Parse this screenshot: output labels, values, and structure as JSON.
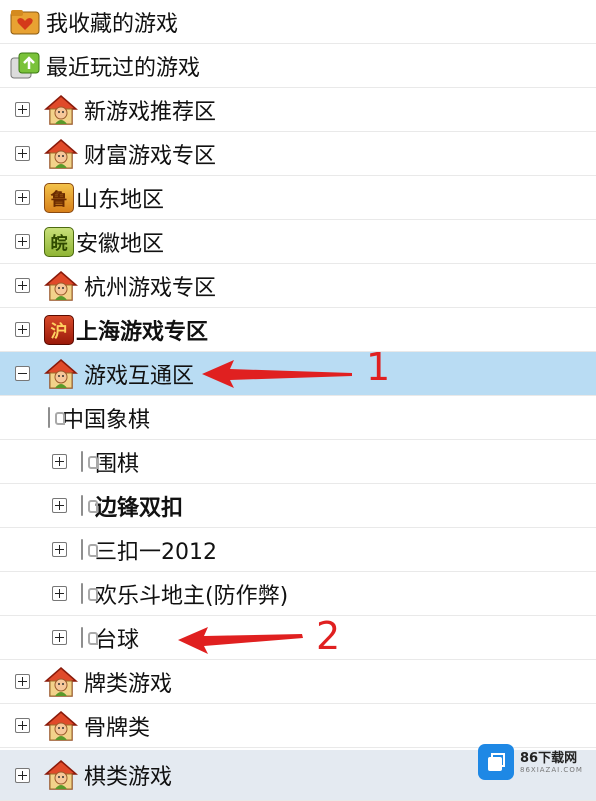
{
  "tree": {
    "favorites": {
      "label": "我收藏的游戏",
      "icon": "heart-folder-icon"
    },
    "recent": {
      "label": "最近玩过的游戏",
      "icon": "recent-games-icon"
    },
    "new_games": {
      "label": "新游戏推荐区",
      "icon": "house-icon"
    },
    "wealth": {
      "label": "财富游戏专区",
      "icon": "house-icon"
    },
    "shandong": {
      "label": "山东地区",
      "icon": "region-badge-icon",
      "badge": "鲁"
    },
    "anhui": {
      "label": "安徽地区",
      "icon": "region-badge-icon",
      "badge": "皖"
    },
    "hangzhou": {
      "label": "杭州游戏专区",
      "icon": "house-icon"
    },
    "shanghai": {
      "label": "上海游戏专区",
      "icon": "region-badge-icon",
      "badge": "沪"
    },
    "interop": {
      "label": "游戏互通区",
      "icon": "house-icon",
      "children": [
        {
          "label": "中国象棋"
        },
        {
          "label": "围棋"
        },
        {
          "label": "边锋双扣"
        },
        {
          "label": "三扣一2012"
        },
        {
          "label": "欢乐斗地主(防作弊)"
        },
        {
          "label": "台球"
        }
      ]
    },
    "cards": {
      "label": "牌类游戏",
      "icon": "house-icon"
    },
    "dominoes": {
      "label": "骨牌类",
      "icon": "house-icon"
    },
    "chess": {
      "label": "棋类游戏",
      "icon": "house-icon"
    }
  },
  "annotations": {
    "first": "1",
    "second": "2"
  },
  "watermark": {
    "name": "86下载网",
    "url": "86XIAZAI.COM"
  },
  "colors": {
    "selected_row": "#b9dcf3",
    "arrow": "#e02020"
  }
}
